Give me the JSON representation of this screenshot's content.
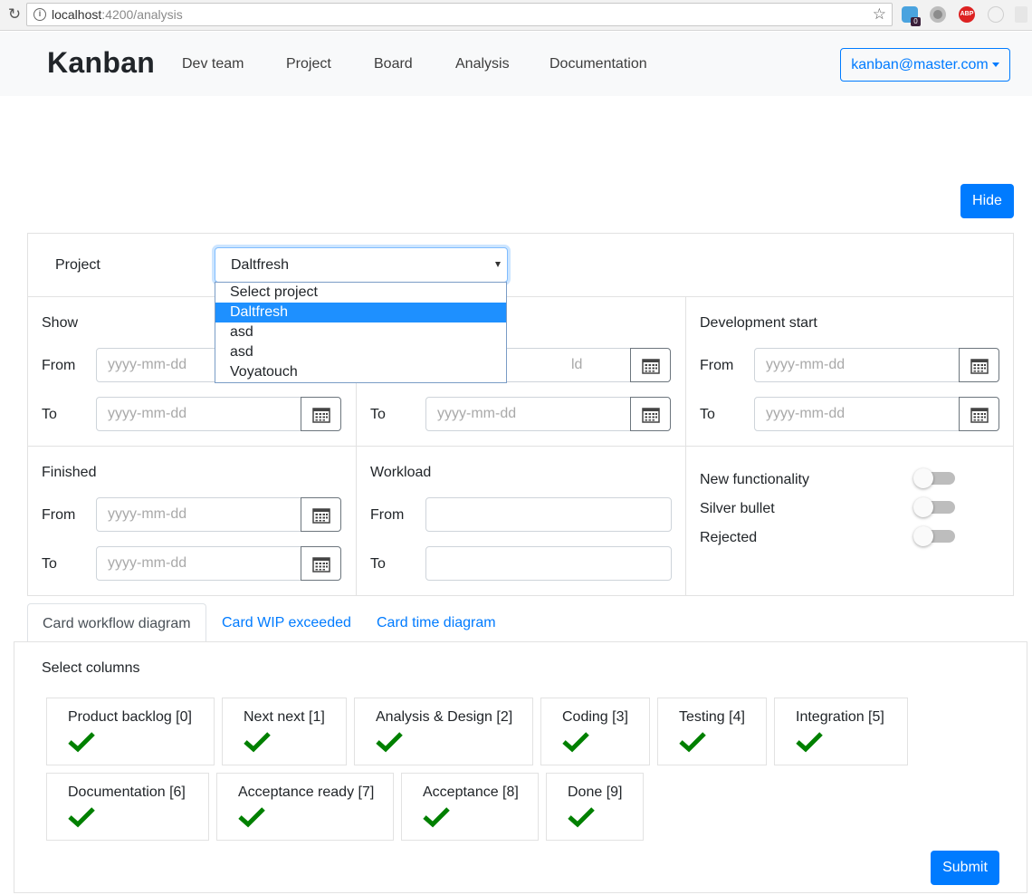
{
  "browser": {
    "url_host": "localhost",
    "url_path": ":4200/analysis",
    "extension_badge": "0",
    "abp_label": "ABP"
  },
  "navbar": {
    "brand": "Kanban",
    "links": [
      "Dev team",
      "Project",
      "Board",
      "Analysis",
      "Documentation"
    ],
    "user": "kanban@master.com"
  },
  "hide_label": "Hide",
  "filters": {
    "project_label": "Project",
    "project_selected": "Daltfresh",
    "project_options": [
      "Select project",
      "Daltfresh",
      "asd",
      "asd",
      "Voyatouch"
    ],
    "date_placeholder": "yyyy-mm-dd",
    "date_placeholder_partial": "ld",
    "from_label": "From",
    "to_label": "To",
    "show_title": "Show",
    "dev_start_title": "Development start",
    "finished_title": "Finished",
    "workload_title": "Workload",
    "toggles": [
      {
        "label": "New functionality",
        "on": false
      },
      {
        "label": "Silver bullet",
        "on": false
      },
      {
        "label": "Rejected",
        "on": false
      }
    ]
  },
  "tabs": [
    "Card workflow diagram",
    "Card WIP exceeded",
    "Card time diagram"
  ],
  "active_tab": "Card workflow diagram",
  "columns_section": {
    "title": "Select columns",
    "columns": [
      {
        "name": "Product backlog [0]",
        "checked": true
      },
      {
        "name": "Next next [1]",
        "checked": true
      },
      {
        "name": "Analysis & Design [2]",
        "checked": true
      },
      {
        "name": "Coding [3]",
        "checked": true
      },
      {
        "name": "Testing [4]",
        "checked": true
      },
      {
        "name": "Integration [5]",
        "checked": true
      },
      {
        "name": "Documentation [6]",
        "checked": true
      },
      {
        "name": "Acceptance ready [7]",
        "checked": true
      },
      {
        "name": "Acceptance [8]",
        "checked": true
      },
      {
        "name": "Done [9]",
        "checked": true
      }
    ],
    "check_color": "#008000"
  },
  "submit_label": "Submit",
  "colors": {
    "primary": "#007bff",
    "navbar_bg": "#f8f9fa"
  }
}
